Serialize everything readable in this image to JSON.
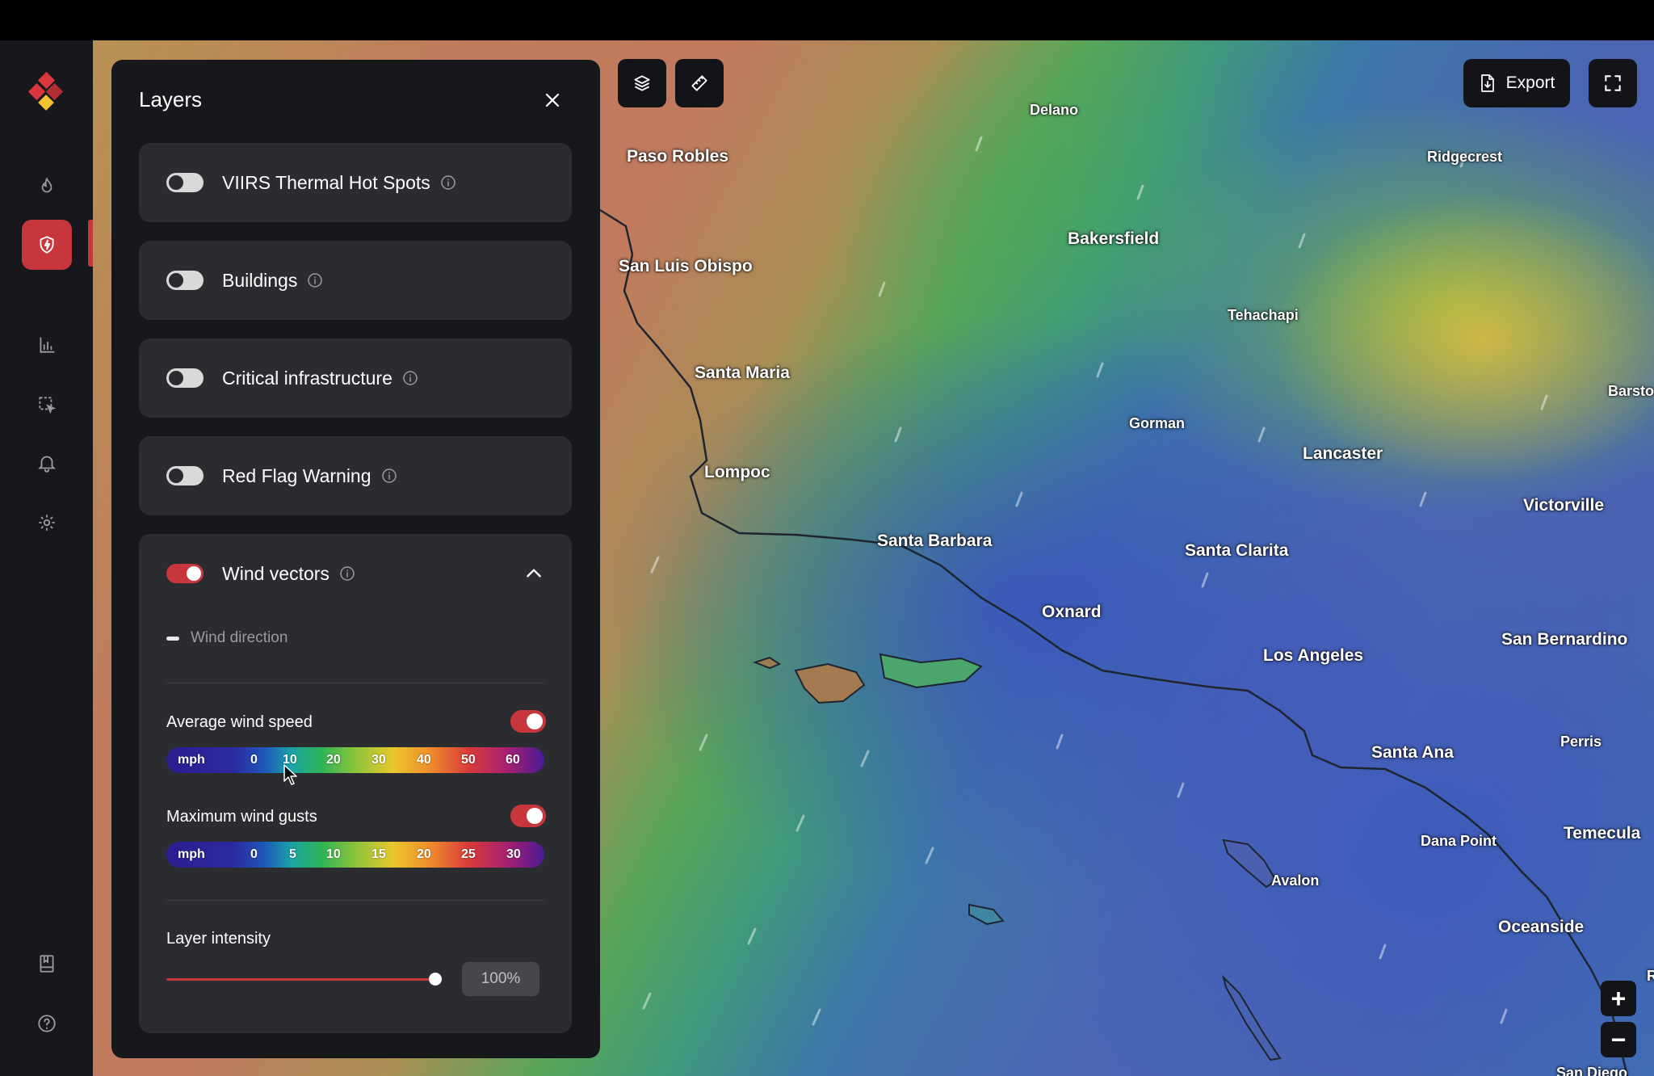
{
  "panel": {
    "title": "Layers",
    "layers": [
      {
        "label": "VIIRS Thermal Hot Spots",
        "on": false
      },
      {
        "label": "Buildings",
        "on": false
      },
      {
        "label": "Critical infrastructure",
        "on": false
      },
      {
        "label": "Red Flag Warning",
        "on": false
      }
    ],
    "wind": {
      "label": "Wind vectors",
      "on": true,
      "direction_label": "Wind direction",
      "avg_speed": {
        "label": "Average wind speed",
        "on": true,
        "unit": "mph",
        "ticks": [
          "0",
          "10",
          "20",
          "30",
          "40",
          "50",
          "60"
        ]
      },
      "max_gusts": {
        "label": "Maximum wind gusts",
        "on": true,
        "unit": "mph",
        "ticks": [
          "0",
          "5",
          "10",
          "15",
          "20",
          "25",
          "30"
        ]
      },
      "intensity": {
        "label": "Layer intensity",
        "value": 1.0,
        "display": "100%"
      }
    }
  },
  "toolbar": {
    "export_label": "Export"
  },
  "map": {
    "cities": [
      {
        "name": "Delano",
        "small": true
      },
      {
        "name": "Paso Robles",
        "small": false
      },
      {
        "name": "Ridgecrest",
        "small": true
      },
      {
        "name": "Bakersfield",
        "small": false
      },
      {
        "name": "San Luis Obispo",
        "small": false
      },
      {
        "name": "Tehachapi",
        "small": true
      },
      {
        "name": "Santa Maria",
        "small": false
      },
      {
        "name": "Barsto",
        "small": true
      },
      {
        "name": "Gorman",
        "small": true
      },
      {
        "name": "Lancaster",
        "small": false
      },
      {
        "name": "Lompoc",
        "small": false
      },
      {
        "name": "Victorville",
        "small": false
      },
      {
        "name": "Santa Barbara",
        "small": false
      },
      {
        "name": "Santa Clarita",
        "small": false
      },
      {
        "name": "Oxnard",
        "small": false
      },
      {
        "name": "San Bernardino",
        "small": false
      },
      {
        "name": "Los Angeles",
        "small": false
      },
      {
        "name": "Perris",
        "small": true
      },
      {
        "name": "Santa Ana",
        "small": false
      },
      {
        "name": "Temecula",
        "small": false
      },
      {
        "name": "Dana Point",
        "small": true
      },
      {
        "name": "Avalon",
        "small": true
      },
      {
        "name": "Oceanside",
        "small": false
      },
      {
        "name": "San Diego",
        "small": true
      },
      {
        "name": "R",
        "small": true
      }
    ]
  },
  "colors": {
    "accent": "#c8363d",
    "panel_bg": "#17181b",
    "card_bg": "#2b2c30"
  }
}
